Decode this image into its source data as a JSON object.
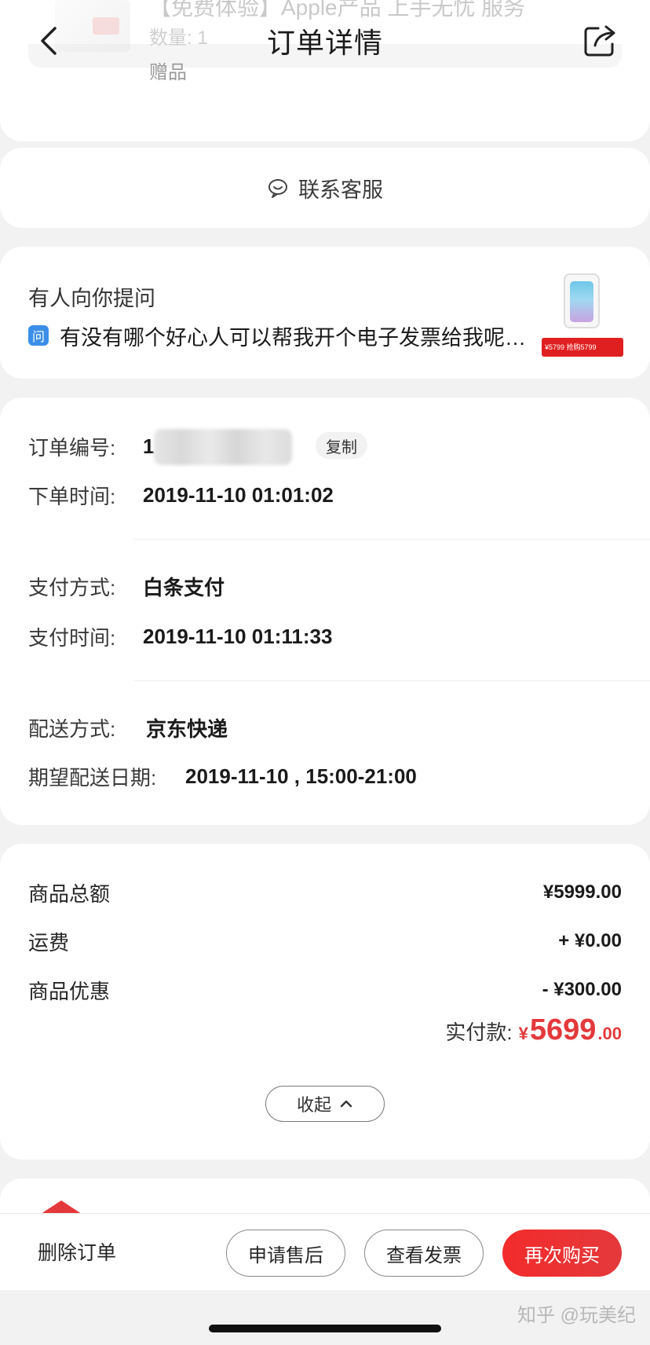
{
  "nav": {
    "title": "订单详情"
  },
  "product_top": {
    "name": "【免费体验】Apple产品 上手无忧 服务",
    "quantity": "数量: 1",
    "gift_label": "赠品"
  },
  "service": {
    "label": "联系客服"
  },
  "question": {
    "heading": "有人向你提问",
    "badge": "问",
    "text": "有没有哪个好心人可以帮我开个电子发票给我呢。...",
    "promo_text": "¥5799 抢购5799"
  },
  "order_info": {
    "order_no_label": "订单编号:",
    "order_no_value": "1",
    "copy_label": "复制",
    "order_time_label": "下单时间:",
    "order_time_value": "2019-11-10 01:01:02",
    "pay_method_label": "支付方式:",
    "pay_method_value": "白条支付",
    "pay_time_label": "支付时间:",
    "pay_time_value": "2019-11-10 01:11:33",
    "delivery_label": "配送方式:",
    "delivery_value": "京东快递",
    "expected_label": "期望配送日期:",
    "expected_value": "2019-11-10 , 15:00-21:00"
  },
  "price": {
    "total_label": "商品总额",
    "total_value": "¥5999.00",
    "shipping_label": "运费",
    "shipping_value": "+ ¥0.00",
    "discount_label": "商品优惠",
    "discount_value": "- ¥300.00",
    "paid_label": "实付款:",
    "paid_symbol": "¥",
    "paid_integer": "5699",
    "paid_decimal": ".00",
    "collapse_label": "收起"
  },
  "actions": {
    "delete_label": "删除订单",
    "after_sale_label": "申请售后",
    "invoice_label": "查看发票",
    "rebuy_label": "再次购买"
  },
  "watermark": "知乎 @玩美纪",
  "colors": {
    "accent": "#e4393c",
    "badge_blue": "#3b8ee8",
    "background": "#f2f2f2"
  }
}
